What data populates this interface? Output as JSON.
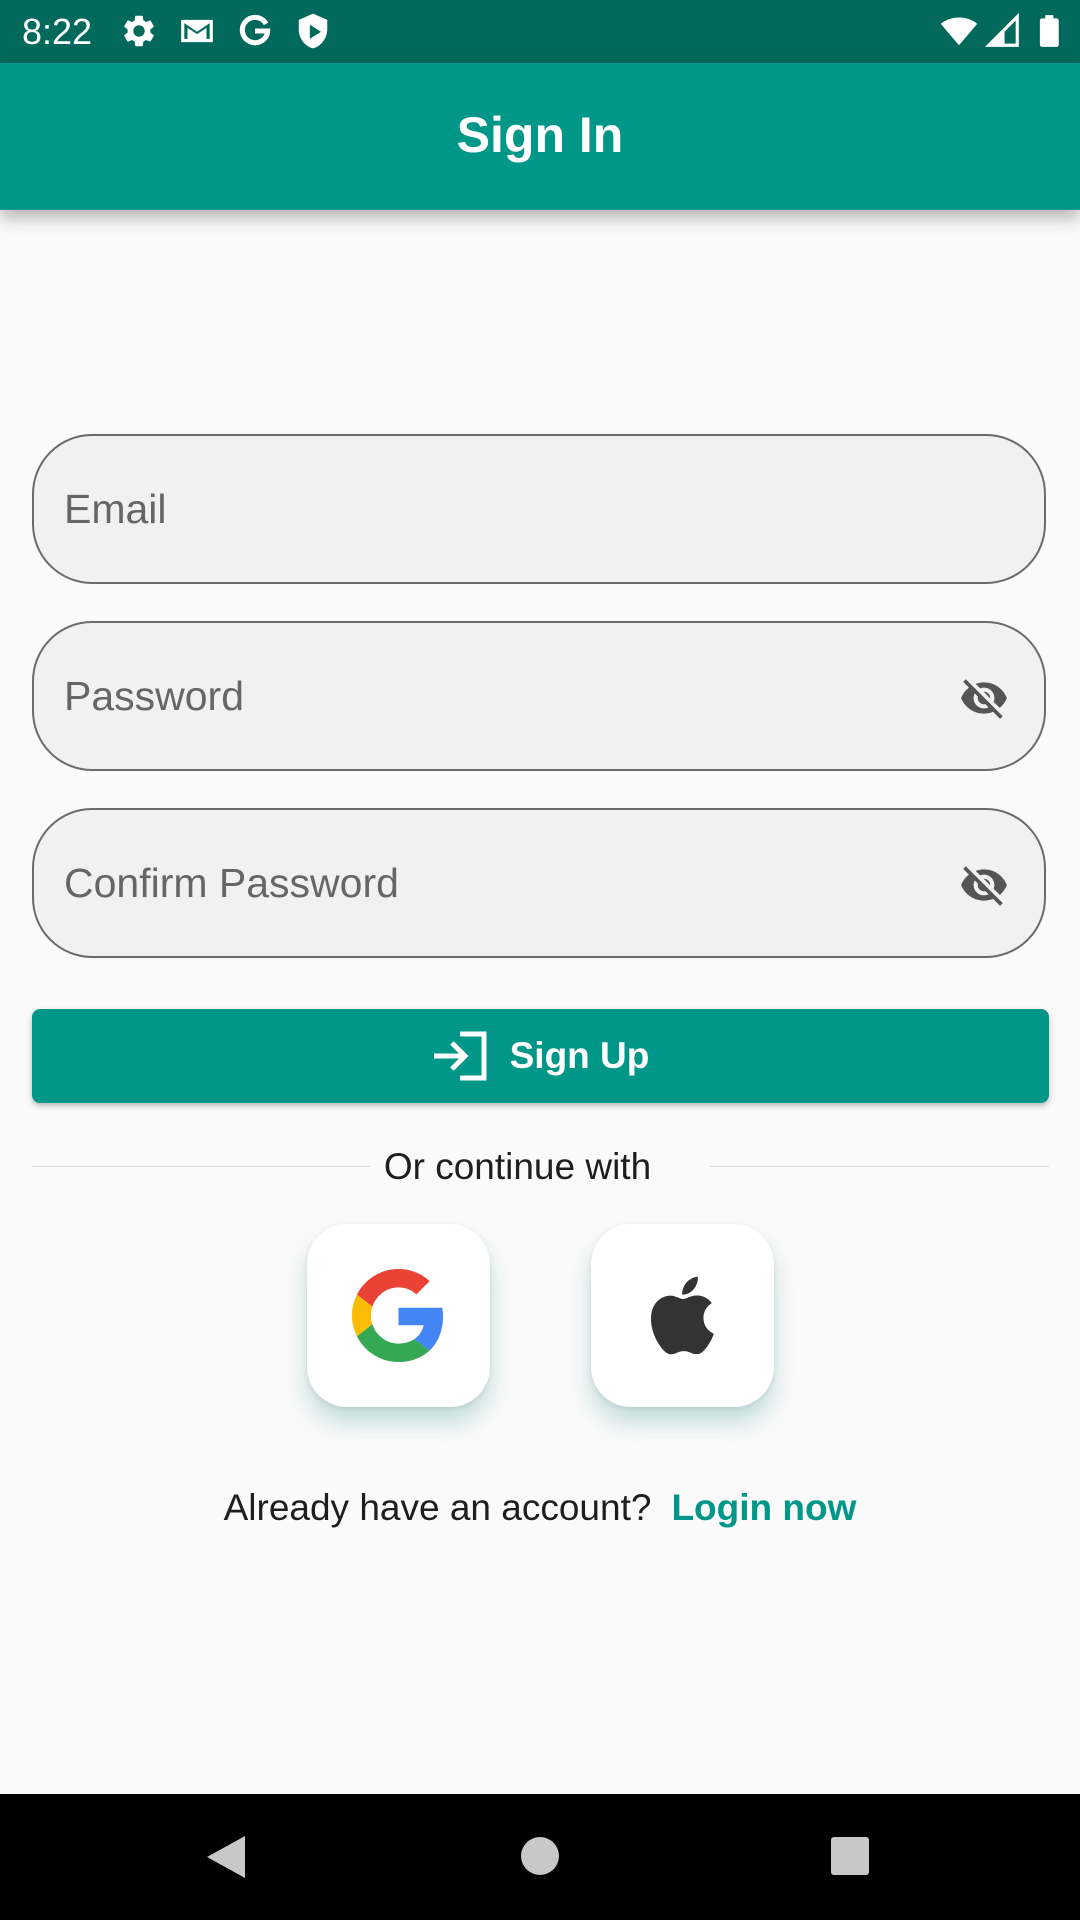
{
  "status_bar": {
    "time": "8:22",
    "left_icons": [
      "gear-icon",
      "gmail-icon",
      "google-g-icon",
      "shield-play-icon"
    ],
    "right_icons": [
      "wifi-icon",
      "signal-icon",
      "battery-icon"
    ]
  },
  "app_bar": {
    "title": "Sign In"
  },
  "form": {
    "email": {
      "placeholder": "Email",
      "value": ""
    },
    "password": {
      "placeholder": "Password",
      "value": "",
      "toggle_icon": "visibility-off-icon"
    },
    "confirm_password": {
      "placeholder": "Confirm Password",
      "value": "",
      "toggle_icon": "visibility-off-icon"
    }
  },
  "signup_button": {
    "label": "Sign Up",
    "icon": "login-icon"
  },
  "divider": {
    "text": "Or continue with"
  },
  "social": [
    {
      "name": "Google",
      "icon": "google-logo-icon"
    },
    {
      "name": "Apple",
      "icon": "apple-logo-icon"
    }
  ],
  "login_prompt": {
    "question": "Already have an account?",
    "link": "Login now"
  },
  "colors": {
    "primary": "#009688",
    "status_bar": "#00695c",
    "background": "#fafafa",
    "field_fill": "#f1f1f1"
  }
}
